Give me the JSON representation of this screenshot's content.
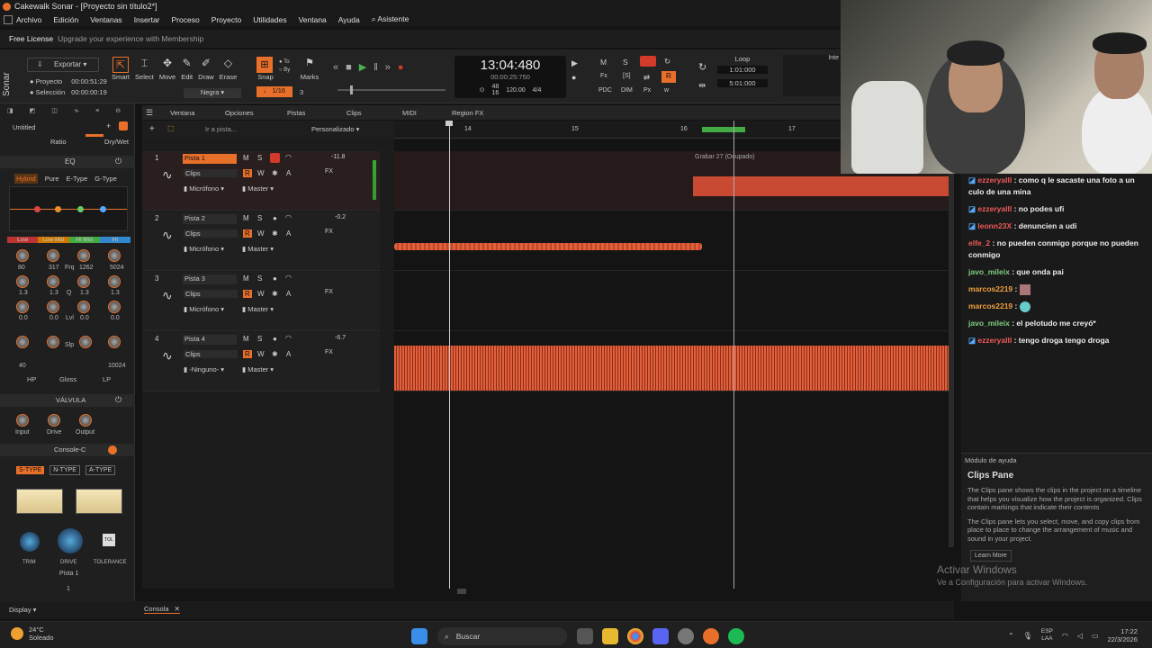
{
  "window": {
    "title": "Cakewalk Sonar - [Proyecto sin título2*]"
  },
  "menu": [
    "Archivo",
    "Edición",
    "Ventanas",
    "Insertar",
    "Proceso",
    "Proyecto",
    "Utilidades",
    "Ventana",
    "Ayuda",
    "Asistente"
  ],
  "license": {
    "label": "Free License",
    "upgrade": "Upgrade your experience with Membership"
  },
  "toolbar": {
    "sonar": "Sonar",
    "export": "Exportar",
    "project": "Proyecto",
    "selection": "Selección",
    "project_time": "00:00:51:29",
    "selection_time": "00:00:00:19",
    "tools": [
      "Smart",
      "Select",
      "Move",
      "Edit",
      "Draw",
      "Erase"
    ],
    "color": "Negra",
    "snap": "Snap",
    "snap_value": "1/16",
    "snap_num": "3",
    "marks": "Marks",
    "to": "To",
    "by": "By",
    "time": "13:04:480",
    "time_sub": "00:00:25:750",
    "bpm_top": "48",
    "bpm_bot": "16",
    "tempo": "120.00",
    "meter": "4/4",
    "loop": "Loop",
    "loop_start": "1:01:000",
    "loop_end": "5:01:000",
    "inter": "Inte",
    "mix_labels": [
      "M",
      "S",
      "R",
      "PDC",
      "DIM",
      "Px"
    ]
  },
  "leftpanel": {
    "preset": "Untitled",
    "ratio": "Ratio",
    "drywet": "Dry/Wet",
    "eq": "EQ",
    "eq_types": [
      "Hybrid",
      "Pure",
      "E-Type",
      "G-Type"
    ],
    "bands": [
      "Low",
      "Low Mid",
      "Hi Mid",
      "Hi"
    ],
    "freqs": [
      "80",
      "317",
      "1262",
      "5024"
    ],
    "gains": [
      "1.3",
      "1.3",
      "1.3",
      "1.3"
    ],
    "qvals": [
      "0.0",
      "0.0",
      "0.0",
      "0.0"
    ],
    "frq": "Frq",
    "q": "Q",
    "lvl": "Lvl",
    "slp": "Slp",
    "hp": "HP",
    "gloss": "Gloss",
    "lp": "LP",
    "hp_val": "40",
    "lp_val": "10024",
    "valve": "VÁLVULA",
    "valve_knobs": [
      "Input",
      "Drive",
      "Output"
    ],
    "console": "Console-C",
    "console_types": [
      "S-TYPE",
      "N-TYPE",
      "A-TYPE"
    ],
    "console_knobs": [
      "TRIM",
      "DRIVE",
      "TOLERANCE"
    ],
    "tol": "TOL",
    "track": "Pista 1",
    "num": "1"
  },
  "trackheader": {
    "items": [
      "Ventana",
      "Opciones",
      "Pistas",
      "Clips",
      "MIDI",
      "Region FX"
    ],
    "goto": "Ir a pista...",
    "custom": "Personalizado"
  },
  "ruler": [
    "14",
    "15",
    "16",
    "17"
  ],
  "tracks": [
    {
      "num": "1",
      "name": "Pista 1",
      "clips": "Clips",
      "input": "Micrófono",
      "output": "Master",
      "vol": "-11.8",
      "fx": "FX"
    },
    {
      "num": "2",
      "name": "Pista 2",
      "clips": "Clips",
      "input": "Micrófono",
      "output": "Master",
      "vol": "-0.2",
      "fx": "FX"
    },
    {
      "num": "3",
      "name": "Pista 3",
      "clips": "Clips",
      "input": "Micrófono",
      "output": "Master",
      "vol": "",
      "fx": "FX"
    },
    {
      "num": "4",
      "name": "Pista 4",
      "clips": "Clips",
      "input": "-Ninguno-",
      "output": "Master",
      "vol": "-6.7",
      "fx": "FX"
    }
  ],
  "recording": {
    "label": "Grabar 27 (Ocupado)"
  },
  "chat": [
    {
      "user": "ezzeryalll",
      "text": "como q le sacaste una foto a un culo de una mina"
    },
    {
      "user": "ezzeryalll",
      "text": "no podes ufi"
    },
    {
      "user": "leonn23X",
      "text": "denuncien a udi"
    },
    {
      "user": "elfe_2",
      "text": "no pueden conmigo porque no pueden conmigo"
    },
    {
      "user": "javo_mileix",
      "text": "que onda pai"
    },
    {
      "user": "marcos2219",
      "text": ""
    },
    {
      "user": "marcos2219",
      "text": ""
    },
    {
      "user": "javo_mileix",
      "text": "el pelotudo me creyó*"
    },
    {
      "user": "ezzeryalll",
      "text": "tengo droga tengo droga"
    }
  ],
  "help": {
    "title": "Módulo de ayuda",
    "heading": "Clips Pane",
    "p1": "The Clips pane shows the clips in the project on a timeline that helps you visualize how the project is organized. Clips contain markings that indicate their contents",
    "p2": "The Clips pane lets you select, move, and copy clips from place to place to change the arrangement of music and sound in your project.",
    "learn": "Learn More"
  },
  "activate": {
    "line1": "Activar Windows",
    "line2": "Ve a Configuración para activar Windows."
  },
  "status": {
    "display": "Display",
    "console": "Consola"
  },
  "taskbar": {
    "temp": "24°C",
    "weather": "Soleado",
    "search": "Buscar",
    "lang1": "ESP",
    "lang2": "LAA",
    "time": "17:22",
    "date": "22/3/2026"
  },
  "colors": {
    "accent": "#e8702a",
    "record": "#d23a2a",
    "wave": "#e2603c"
  }
}
